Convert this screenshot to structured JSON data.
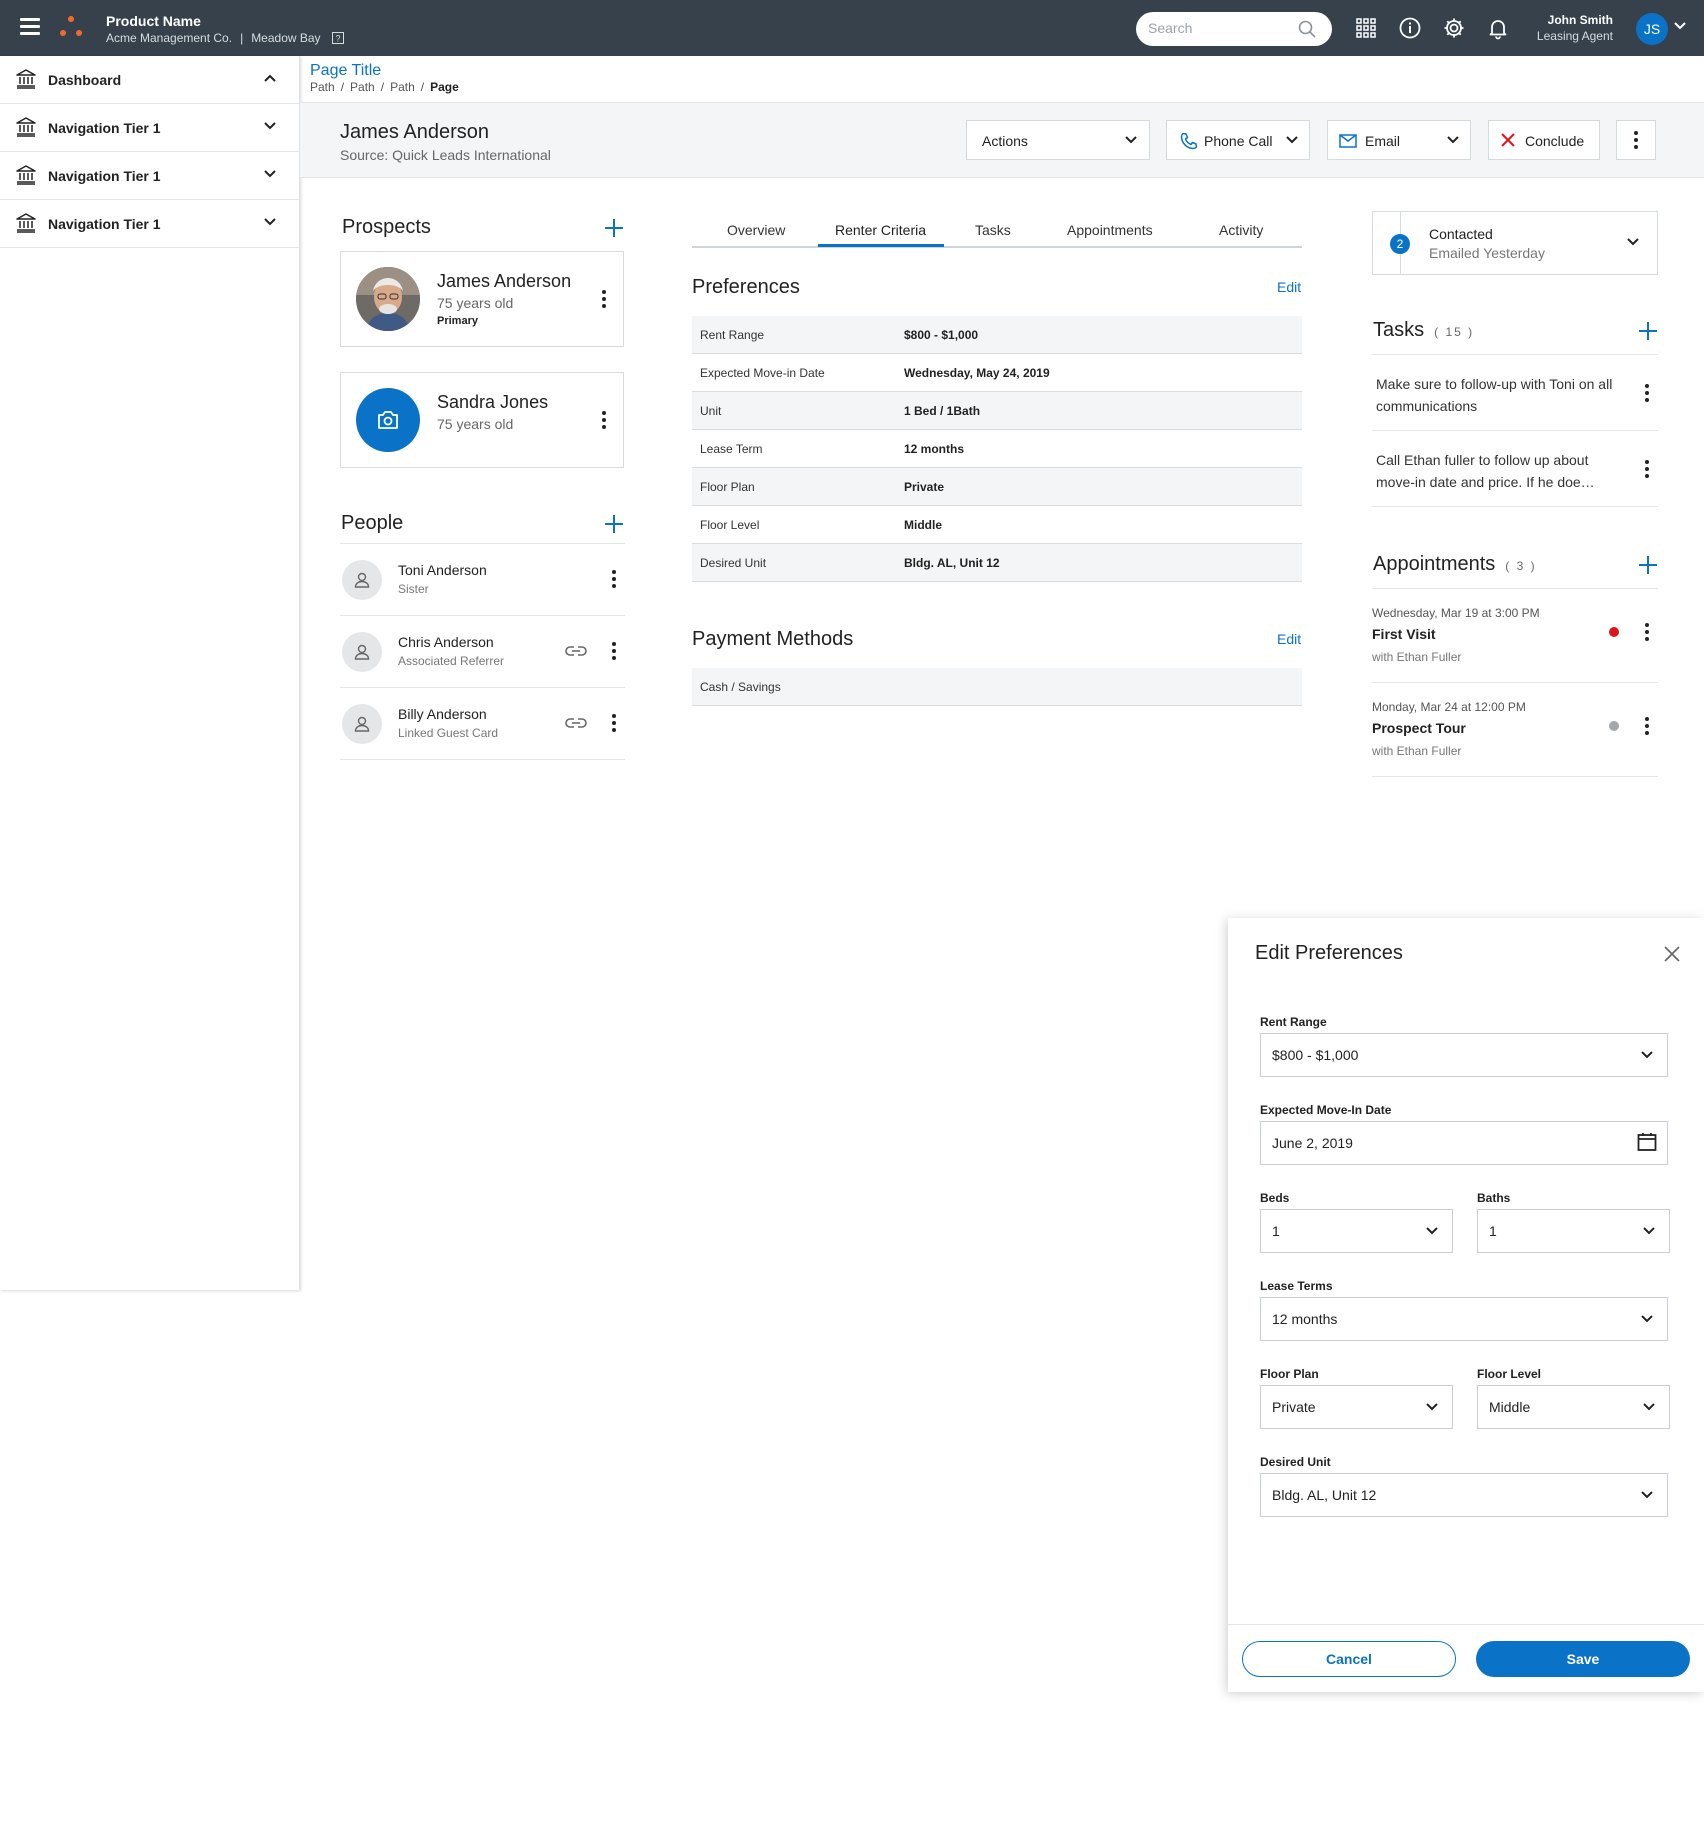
{
  "topbar": {
    "product_name": "Product Name",
    "company": "Acme Management Co.",
    "separator": "|",
    "property": "Meadow Bay",
    "search_placeholder": "Search",
    "user_name": "John Smith",
    "user_role": "Leasing Agent",
    "user_initials": "JS",
    "icons": [
      "menu-icon",
      "logo-icon",
      "search-icon",
      "apps-grid-icon",
      "info-icon",
      "gear-icon",
      "bell-icon",
      "chevron-down-icon"
    ]
  },
  "sidebar": {
    "items": [
      {
        "label": "Dashboard",
        "icon": "bank-icon",
        "expanded": true
      },
      {
        "label": "Navigation Tier 1",
        "icon": "bank-icon",
        "expanded": false
      },
      {
        "label": "Navigation Tier 1",
        "icon": "bank-icon",
        "expanded": false
      },
      {
        "label": "Navigation Tier 1",
        "icon": "bank-icon",
        "expanded": false
      }
    ]
  },
  "page": {
    "title": "Page Title",
    "breadcrumb": [
      "Path",
      "Path",
      "Path",
      "Page"
    ]
  },
  "header": {
    "name": "James Anderson",
    "source": "Source: Quick Leads International",
    "actions_label": "Actions",
    "phone_label": "Phone Call",
    "email_label": "Email",
    "conclude_label": "Conclude"
  },
  "prospects": {
    "title": "Prospects",
    "cards": [
      {
        "name": "James Anderson",
        "age": "75 years old",
        "tag": "Primary"
      },
      {
        "name": "Sandra Jones",
        "age": "75 years old"
      }
    ]
  },
  "people": {
    "title": "People",
    "items": [
      {
        "name": "Toni Anderson",
        "relation": "Sister"
      },
      {
        "name": "Chris Anderson",
        "relation": "Associated Referrer"
      },
      {
        "name": "Billy Anderson",
        "relation": "Linked Guest Card"
      }
    ]
  },
  "tabs": {
    "items": [
      "Overview",
      "Renter Criteria",
      "Tasks",
      "Appointments",
      "Activity"
    ],
    "active": "Renter Criteria"
  },
  "preferences": {
    "title": "Preferences",
    "edit_label": "Edit",
    "rows": [
      {
        "key": "Rent Range",
        "value": "$800 - $1,000"
      },
      {
        "key": "Expected Move-in Date",
        "value": "Wednesday, May 24, 2019"
      },
      {
        "key": "Unit",
        "value": "1 Bed / 1Bath"
      },
      {
        "key": "Lease Term",
        "value": "12 months"
      },
      {
        "key": "Floor Plan",
        "value": "Private"
      },
      {
        "key": "Floor Level",
        "value": "Middle"
      },
      {
        "key": "Desired Unit",
        "value": "Bldg. AL, Unit 12"
      }
    ]
  },
  "payment": {
    "title": "Payment Methods",
    "edit_label": "Edit",
    "rows": [
      {
        "key": "Cash / Savings"
      }
    ]
  },
  "status": {
    "step": "2",
    "title": "Contacted",
    "subtitle": "Emailed Yesterday"
  },
  "tasks": {
    "title": "Tasks",
    "count": "( 15 )",
    "items": [
      "Make sure to follow-up with Toni on all communications",
      "Call Ethan fuller to follow up about move-in date and price. If he doe…"
    ]
  },
  "appointments": {
    "title": "Appointments",
    "count": "( 3 )",
    "items": [
      {
        "date": "Wednesday, Mar 19 at 3:00 PM",
        "title": "First Visit",
        "with": "with Ethan Fuller",
        "status_color": "#e0151b"
      },
      {
        "date": "Monday, Mar 24 at 12:00 PM",
        "title": "Prospect Tour",
        "with": "with Ethan Fuller",
        "status_color": "#a3a8ac"
      }
    ]
  },
  "edit_panel": {
    "title": "Edit Preferences",
    "fields": {
      "rent_range": {
        "label": "Rent Range",
        "value": "$800 - $1,000"
      },
      "move_in": {
        "label": "Expected Move-In Date",
        "value": "June 2, 2019"
      },
      "beds": {
        "label": "Beds",
        "value": "1"
      },
      "baths": {
        "label": "Baths",
        "value": "1"
      },
      "lease_terms": {
        "label": "Lease Terms",
        "value": "12 months"
      },
      "floor_plan": {
        "label": "Floor Plan",
        "value": "Private"
      },
      "floor_level": {
        "label": "Floor Level",
        "value": "Middle"
      },
      "desired_unit": {
        "label": "Desired Unit",
        "value": "Bldg. AL, Unit 12"
      }
    },
    "cancel_label": "Cancel",
    "save_label": "Save"
  },
  "colors": {
    "topbar": "#36414b",
    "accent": "#0a73c7",
    "brand_orange": "#f26a2e",
    "danger": "#e0151b"
  }
}
